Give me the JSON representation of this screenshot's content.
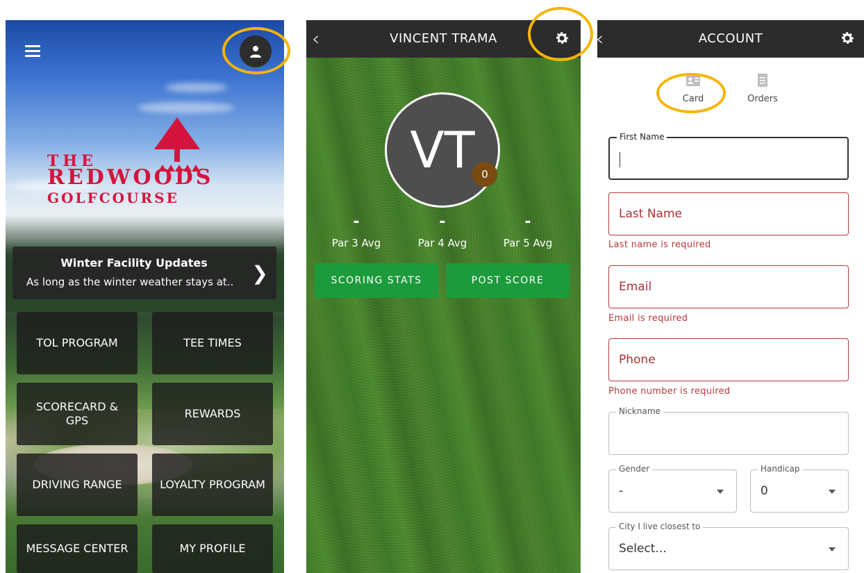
{
  "home": {
    "logo": {
      "line1": "THE",
      "line2": "REDWOODS",
      "line3": "GOLFCOURSE"
    },
    "banner": {
      "title": "Winter Facility Updates",
      "subtitle": "As long as the winter weather stays at..",
      "chevron": "❯"
    },
    "tiles": [
      {
        "label": "TOL PROGRAM"
      },
      {
        "label": "TEE TIMES"
      },
      {
        "label": "SCORECARD & GPS"
      },
      {
        "label": "REWARDS"
      },
      {
        "label": "DRIVING RANGE"
      },
      {
        "label": "LOYALTY PROGRAM"
      },
      {
        "label": "MESSAGE CENTER"
      },
      {
        "label": "MY PROFILE"
      }
    ],
    "colors": {
      "logo": "#d4143c",
      "tile": "#1c1c1c"
    },
    "icons": [
      "hamburger-menu-icon",
      "user-icon"
    ]
  },
  "profile": {
    "header": {
      "back": "‹",
      "title": "VINCENT TRAMA"
    },
    "avatar": {
      "initials": "VT",
      "badge": "0"
    },
    "stats": [
      {
        "value": "-",
        "label": "Par 3 Avg"
      },
      {
        "value": "-",
        "label": "Par 4 Avg"
      },
      {
        "value": "-",
        "label": "Par 5 Avg"
      }
    ],
    "buttons": {
      "scoring": "SCORING STATS",
      "post": "POST SCORE"
    },
    "colors": {
      "button": "#1d9a3b",
      "badge": "#7a4a10"
    },
    "icons": [
      "back-icon",
      "gear-icon"
    ]
  },
  "account": {
    "header": {
      "back": "‹",
      "title": "ACCOUNT"
    },
    "tabs": {
      "card": "Card",
      "orders": "Orders"
    },
    "fields": {
      "first_name_label": "First Name",
      "last_name": "Last Name",
      "last_name_error": "Last name is required",
      "email": "Email",
      "email_error": "Email is required",
      "phone": "Phone",
      "phone_error": "Phone number is required",
      "nickname_label": "Nickname",
      "gender_label": "Gender",
      "gender_value": "-",
      "handicap_label": "Handicap",
      "handicap_value": "0",
      "city_label": "City I live closest to",
      "city_value": "Select..."
    },
    "colors": {
      "error": "#b33a3a",
      "annotation": "#f7b500"
    },
    "icons": [
      "back-icon",
      "gear-icon",
      "id-card-icon",
      "receipt-icon",
      "chevron-down-icon"
    ]
  }
}
